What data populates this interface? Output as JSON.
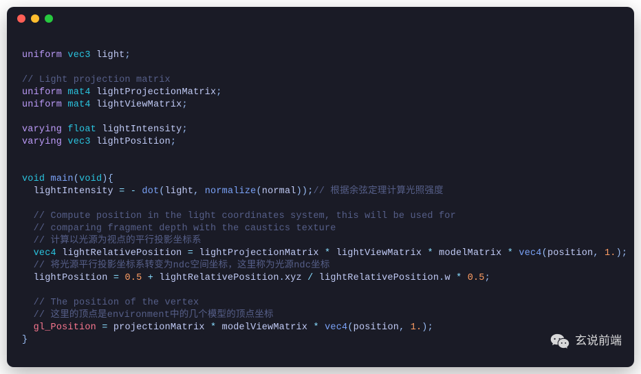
{
  "watermark": {
    "text": "玄说前端"
  },
  "code": {
    "lines": [
      [],
      [
        [
          "kw",
          "uniform"
        ],
        [
          "",
          ""
        ],
        [
          "",
          " "
        ],
        [
          "type",
          "vec3"
        ],
        [
          "",
          " "
        ],
        [
          "ident",
          "light"
        ],
        [
          "punct",
          ";"
        ]
      ],
      [],
      [
        [
          "comment",
          "// Light projection matrix"
        ]
      ],
      [
        [
          "kw",
          "uniform"
        ],
        [
          "",
          " "
        ],
        [
          "type",
          "mat4"
        ],
        [
          "",
          " "
        ],
        [
          "ident",
          "lightProjectionMatrix"
        ],
        [
          "punct",
          ";"
        ]
      ],
      [
        [
          "kw",
          "uniform"
        ],
        [
          "",
          " "
        ],
        [
          "type",
          "mat4"
        ],
        [
          "",
          " "
        ],
        [
          "ident",
          "lightViewMatrix"
        ],
        [
          "punct",
          ";"
        ]
      ],
      [],
      [
        [
          "kw",
          "varying"
        ],
        [
          "",
          " "
        ],
        [
          "type",
          "float"
        ],
        [
          "",
          " "
        ],
        [
          "ident",
          "lightIntensity"
        ],
        [
          "punct",
          ";"
        ]
      ],
      [
        [
          "kw",
          "varying"
        ],
        [
          "",
          " "
        ],
        [
          "type",
          "vec3"
        ],
        [
          "",
          " "
        ],
        [
          "ident",
          "lightPosition"
        ],
        [
          "punct",
          ";"
        ]
      ],
      [],
      [],
      [
        [
          "type",
          "void"
        ],
        [
          "",
          " "
        ],
        [
          "fn",
          "main"
        ],
        [
          "punct",
          "("
        ],
        [
          "type",
          "void"
        ],
        [
          "punct",
          ")"
        ],
        [
          "punct",
          "{"
        ]
      ],
      [
        [
          "",
          "  "
        ],
        [
          "ident",
          "lightIntensity"
        ],
        [
          "",
          " "
        ],
        [
          "op",
          "="
        ],
        [
          "",
          " "
        ],
        [
          "op",
          "-"
        ],
        [
          "",
          " "
        ],
        [
          "fn",
          "dot"
        ],
        [
          "punct",
          "("
        ],
        [
          "ident",
          "light"
        ],
        [
          "punct",
          ","
        ],
        [
          "",
          " "
        ],
        [
          "fn",
          "normalize"
        ],
        [
          "punct",
          "("
        ],
        [
          "ident",
          "normal"
        ],
        [
          "punct",
          "))"
        ],
        [
          "punct",
          ";"
        ],
        [
          "comment",
          "// 根据余弦定理计算光照强度"
        ]
      ],
      [],
      [
        [
          "",
          "  "
        ],
        [
          "comment",
          "// Compute position in the light coordinates system, this will be used for"
        ]
      ],
      [
        [
          "",
          "  "
        ],
        [
          "comment",
          "// comparing fragment depth with the caustics texture"
        ]
      ],
      [
        [
          "",
          "  "
        ],
        [
          "comment",
          "// 计算以光源为视点的平行投影坐标系"
        ]
      ],
      [
        [
          "",
          "  "
        ],
        [
          "type",
          "vec4"
        ],
        [
          "",
          " "
        ],
        [
          "ident",
          "lightRelativePosition"
        ],
        [
          "",
          " "
        ],
        [
          "op",
          "="
        ],
        [
          "",
          " "
        ],
        [
          "ident",
          "lightProjectionMatrix"
        ],
        [
          "",
          " "
        ],
        [
          "op",
          "*"
        ],
        [
          "",
          " "
        ],
        [
          "ident",
          "lightViewMatrix"
        ],
        [
          "",
          " "
        ],
        [
          "op",
          "*"
        ],
        [
          "",
          " "
        ],
        [
          "ident",
          "modelMatrix"
        ],
        [
          "",
          " "
        ],
        [
          "op",
          "*"
        ],
        [
          "",
          " "
        ],
        [
          "fn",
          "vec4"
        ],
        [
          "punct",
          "("
        ],
        [
          "ident",
          "position"
        ],
        [
          "punct",
          ","
        ],
        [
          "",
          " "
        ],
        [
          "num",
          "1."
        ],
        [
          "punct",
          ")"
        ],
        [
          "punct",
          ";"
        ]
      ],
      [
        [
          "",
          "  "
        ],
        [
          "comment",
          "// 将光源平行投影坐标系转变为ndc空间坐标，这里称为光源ndc坐标"
        ]
      ],
      [
        [
          "",
          "  "
        ],
        [
          "ident",
          "lightPosition"
        ],
        [
          "",
          " "
        ],
        [
          "op",
          "="
        ],
        [
          "",
          " "
        ],
        [
          "num",
          "0.5"
        ],
        [
          "",
          " "
        ],
        [
          "op",
          "+"
        ],
        [
          "",
          " "
        ],
        [
          "ident",
          "lightRelativePosition"
        ],
        [
          "punct",
          "."
        ],
        [
          "ident",
          "xyz"
        ],
        [
          "",
          " "
        ],
        [
          "op",
          "/"
        ],
        [
          "",
          " "
        ],
        [
          "ident",
          "lightRelativePosition"
        ],
        [
          "punct",
          "."
        ],
        [
          "ident",
          "w"
        ],
        [
          "",
          " "
        ],
        [
          "op",
          "*"
        ],
        [
          "",
          " "
        ],
        [
          "num",
          "0.5"
        ],
        [
          "punct",
          ";"
        ]
      ],
      [],
      [
        [
          "",
          "  "
        ],
        [
          "comment",
          "// The position of the vertex"
        ]
      ],
      [
        [
          "",
          "  "
        ],
        [
          "comment",
          "// 这里的顶点是environment中的几个模型的顶点坐标"
        ]
      ],
      [
        [
          "",
          "  "
        ],
        [
          "builtin",
          "gl_Position"
        ],
        [
          "",
          " "
        ],
        [
          "op",
          "="
        ],
        [
          "",
          " "
        ],
        [
          "ident",
          "projectionMatrix"
        ],
        [
          "",
          " "
        ],
        [
          "op",
          "*"
        ],
        [
          "",
          " "
        ],
        [
          "ident",
          "modelViewMatrix"
        ],
        [
          "",
          " "
        ],
        [
          "op",
          "*"
        ],
        [
          "",
          " "
        ],
        [
          "fn",
          "vec4"
        ],
        [
          "punct",
          "("
        ],
        [
          "ident",
          "position"
        ],
        [
          "punct",
          ","
        ],
        [
          "",
          " "
        ],
        [
          "num",
          "1."
        ],
        [
          "punct",
          ")"
        ],
        [
          "punct",
          ";"
        ]
      ],
      [
        [
          "punct",
          "}"
        ]
      ]
    ]
  }
}
